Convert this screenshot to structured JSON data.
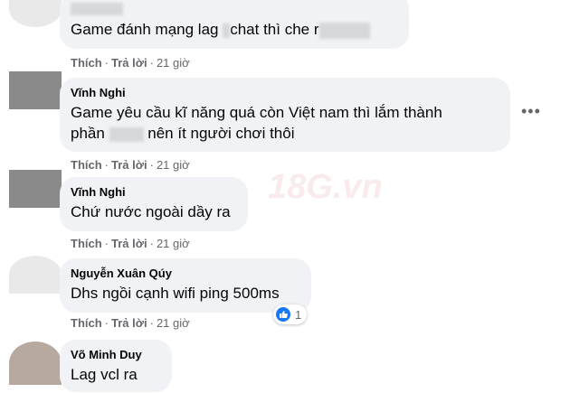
{
  "actions": {
    "like": "Thích",
    "reply": "Trả lời",
    "separator": "·"
  },
  "comments": [
    {
      "author": "",
      "lines": [
        "Game đánh mạng lag ",
        "chat thì che r"
      ],
      "time": "21 giờ"
    },
    {
      "author": "Vĩnh Nghi",
      "lines": [
        "Game yêu cầu kĩ năng quá còn Việt nam thì lắm thành",
        "phần ",
        " nên ít người chơi thôi"
      ],
      "time": "21 giờ"
    },
    {
      "author": "Vĩnh Nghi",
      "lines": [
        "Chứ nước ngoài dầy ra"
      ],
      "time": "21 giờ"
    },
    {
      "author": "Nguyễn Xuân Qúy",
      "lines": [
        "Dhs ngồi cạnh wifi ping 500ms"
      ],
      "time": "21 giờ",
      "reaction": {
        "icon": "like-icon",
        "count": "1"
      }
    },
    {
      "author": "Võ Minh Duy",
      "lines": [
        "Lag vcl ra"
      ]
    }
  ],
  "watermark": "18G.vn",
  "colors": {
    "bubble": "#f0f2f5",
    "meta": "#65676b",
    "like": "#1877f2"
  }
}
